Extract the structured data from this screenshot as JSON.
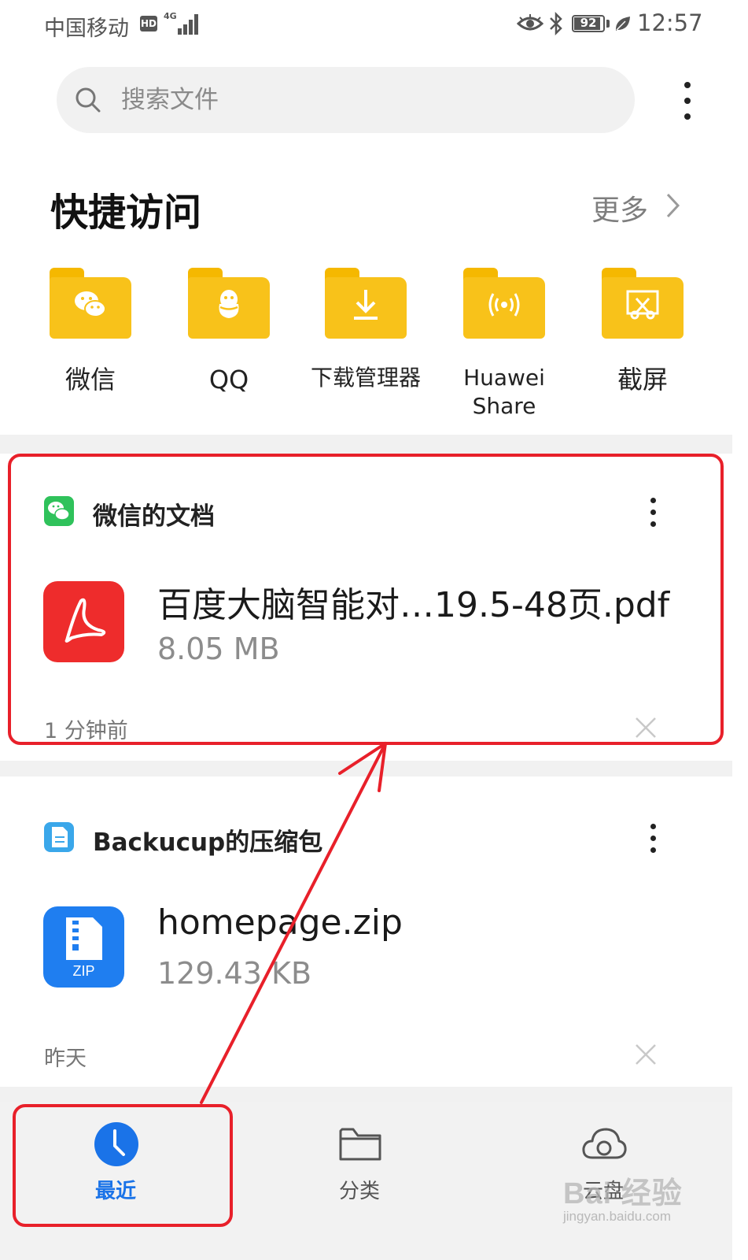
{
  "status_bar": {
    "carrier": "中国移动",
    "hd": "HD",
    "network": "4G",
    "battery": "92",
    "battery_level": 0.92,
    "time": "12:57"
  },
  "search": {
    "placeholder": "搜索文件"
  },
  "quick_access": {
    "title": "快捷访问",
    "more_label": "更多",
    "items": [
      {
        "label": "微信",
        "icon": "wechat-icon"
      },
      {
        "label": "QQ",
        "icon": "qq-penguin-icon"
      },
      {
        "label": "下载管理器",
        "icon": "download-icon"
      },
      {
        "label": "Huawei Share",
        "icon": "wireless-share-icon"
      },
      {
        "label": "截屏",
        "icon": "screenshot-icon"
      }
    ]
  },
  "recent_cards": [
    {
      "source": "微信的文档",
      "source_icon": "wechat-icon",
      "file_name": "百度大脑智能对…19.5-48页.pdf",
      "file_size": "8.05 MB",
      "file_icon": "pdf-icon",
      "time": "1 分钟前"
    },
    {
      "source": "Backucup的压缩包",
      "source_icon": "document-icon",
      "file_name": "homepage.zip",
      "file_size": "129.43 KB",
      "file_icon": "zip-icon",
      "file_icon_label": "ZIP",
      "time": "昨天"
    }
  ],
  "bottom_nav": {
    "items": [
      {
        "label": "最近",
        "icon": "clock-icon",
        "active": true
      },
      {
        "label": "分类",
        "icon": "folder-icon",
        "active": false
      },
      {
        "label": "云盘",
        "icon": "cloud-icon",
        "active": false
      }
    ]
  },
  "watermark": {
    "logo": "Bai 经验",
    "url": "jingyan.baidu.com"
  },
  "colors": {
    "accent": "#1a73e8",
    "folder": "#f8c21a",
    "pdf_red": "#ee2c2c",
    "zip_blue": "#1f7ef0",
    "wechat_green": "#2fc25b",
    "annotation_red": "#e8202a"
  }
}
